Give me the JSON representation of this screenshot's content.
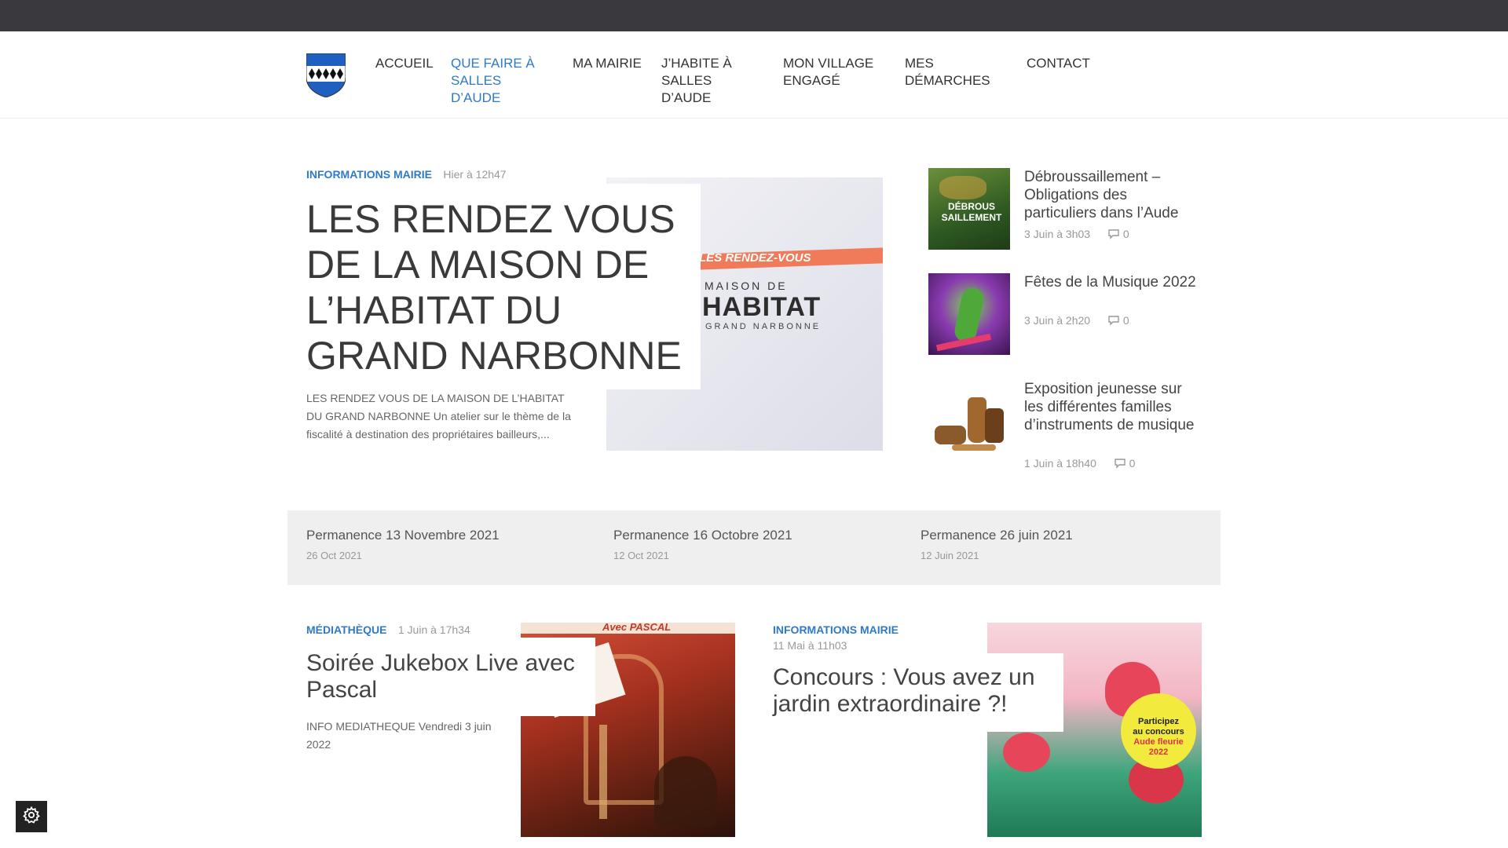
{
  "nav": {
    "items": [
      {
        "label": "ACCUEIL",
        "active": false
      },
      {
        "label": "QUE FAIRE À SALLES D’AUDE",
        "active": true
      },
      {
        "label": "MA MAIRIE",
        "active": false
      },
      {
        "label": "J’HABITE À SALLES D’AUDE",
        "active": false
      },
      {
        "label": "MON VILLAGE ENGAGÉ",
        "active": false
      },
      {
        "label": "MES DÉMARCHES",
        "active": false
      },
      {
        "label": "CONTACT",
        "active": false
      }
    ]
  },
  "featured": {
    "category": "INFORMATIONS MAIRIE",
    "time": "Hier à 12h47",
    "title": "LES RENDEZ VOUS DE LA MAISON DE L’HABITAT DU GRAND NARBONNE",
    "excerpt": "LES RENDEZ VOUS DE LA MAISON DE L’HABITAT DU GRAND NARBONNE Un atelier sur le thème de la fiscalité à destination des propriétaires bailleurs,...",
    "image_text": {
      "banner": "LES RENDEZ-VOUS",
      "line1": "MAISON DE",
      "line2": "HABITAT",
      "line3": "GRAND NARBONNE"
    }
  },
  "side_posts": [
    {
      "title": "Débroussaillement – Obligations des particuliers dans l’Aude",
      "date": "3 Juin à 3h03",
      "comments": "0",
      "thumb_text": "DÉBROUS SAILLEMENT"
    },
    {
      "title": "Fêtes de la Musique 2022",
      "date": "3 Juin à 2h20",
      "comments": "0"
    },
    {
      "title": "Exposition jeunesse sur les différentes familles d’instruments de musique",
      "date": "1 Juin à 18h40",
      "comments": "0"
    }
  ],
  "strip": [
    {
      "title": "Permanence 13 Novembre 2021",
      "date": "26 Oct 2021"
    },
    {
      "title": "Permanence 16 Octobre 2021",
      "date": "12 Oct 2021"
    },
    {
      "title": "Permanence 26 juin 2021",
      "date": "12 Juin 2021"
    }
  ],
  "bottom_posts": [
    {
      "category": "MÉDIATHÈQUE",
      "time": "1 Juin à 17h34",
      "title": "Soirée Jukebox Live avec Pascal",
      "excerpt": "INFO MEDIATHEQUE Vendredi 3 juin 2022",
      "image_text": "Avec PASCAL"
    },
    {
      "category": "INFORMATIONS MAIRIE",
      "time": "11 Mai à 11h03",
      "title": "Concours : Vous avez un jardin extraordinaire ?!",
      "image_text": {
        "line1": "Participez",
        "line2": "au concours",
        "line3": "Aude fleurie",
        "line4": "2022"
      }
    }
  ],
  "colors": {
    "accent": "#2f79c9",
    "topbar": "#3a3a3e",
    "strip": "#efefef"
  },
  "icons": {
    "settings": "gear-icon",
    "comments": "comment-icon"
  }
}
